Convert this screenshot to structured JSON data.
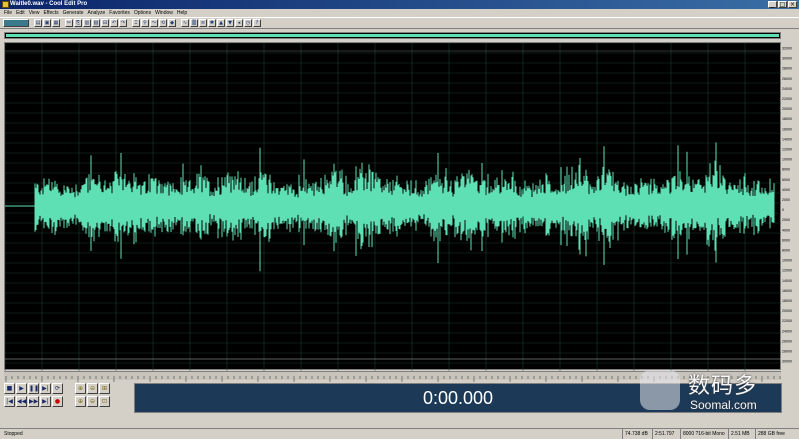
{
  "window": {
    "title": "Waitle0.wav - Cool Edit Pro"
  },
  "menu": [
    "File",
    "Edit",
    "View",
    "Effects",
    "Generate",
    "Analyze",
    "Favorites",
    "Options",
    "Window",
    "Help"
  ],
  "toolbar": {
    "icons": [
      "mode-toggle-icon",
      "open-icon",
      "save-icon",
      "save-all-icon",
      "cut-icon",
      "copy-icon",
      "paste-icon",
      "mix-paste-icon",
      "trim-icon",
      "undo-icon",
      "redo-icon",
      "select-icon",
      "zoom-icon",
      "envelope-icon",
      "loop-icon",
      "cue-icon",
      "frequency-icon",
      "spectral-icon",
      "waveform-icon",
      "noise-icon",
      "amplify-icon",
      "normalize-icon",
      "reverse-icon",
      "time-icon",
      "help-icon"
    ]
  },
  "ruler_y_labels": [
    "32000",
    "30000",
    "28000",
    "26000",
    "24000",
    "22000",
    "20000",
    "18000",
    "16000",
    "14000",
    "12000",
    "10000",
    "8000",
    "6000",
    "4000",
    "2000",
    "0",
    "2000",
    "4000",
    "6000",
    "8000",
    "10000",
    "12000",
    "14000",
    "16000",
    "18000",
    "20000",
    "22000",
    "24000",
    "26000",
    "28000",
    "30000"
  ],
  "time_display": "0:00.000",
  "transport": {
    "row1": [
      "stop-icon",
      "play-icon",
      "pause-icon",
      "play-to-end-icon",
      "loop-icon"
    ],
    "row2": [
      "go-start-icon",
      "rewind-icon",
      "fast-forward-icon",
      "go-end-icon",
      "record-icon"
    ]
  },
  "zoom_buttons": [
    "zoom-in-icon",
    "zoom-out-icon",
    "zoom-full-icon",
    "zoom-in-vertical-icon",
    "zoom-out-vertical-icon",
    "zoom-selection-icon"
  ],
  "watermark": {
    "cn": "数码多",
    "en": "Soomal.com"
  },
  "status": {
    "state": "Stopped",
    "fields": [
      "74.738 dB",
      "2:51.797",
      "8000 ?16-bit Mono",
      "2.51 MB",
      "288 GB free"
    ]
  },
  "colors": {
    "waveform": "#5fe0b4",
    "background": "#000000",
    "grid": "#1d4a36"
  }
}
